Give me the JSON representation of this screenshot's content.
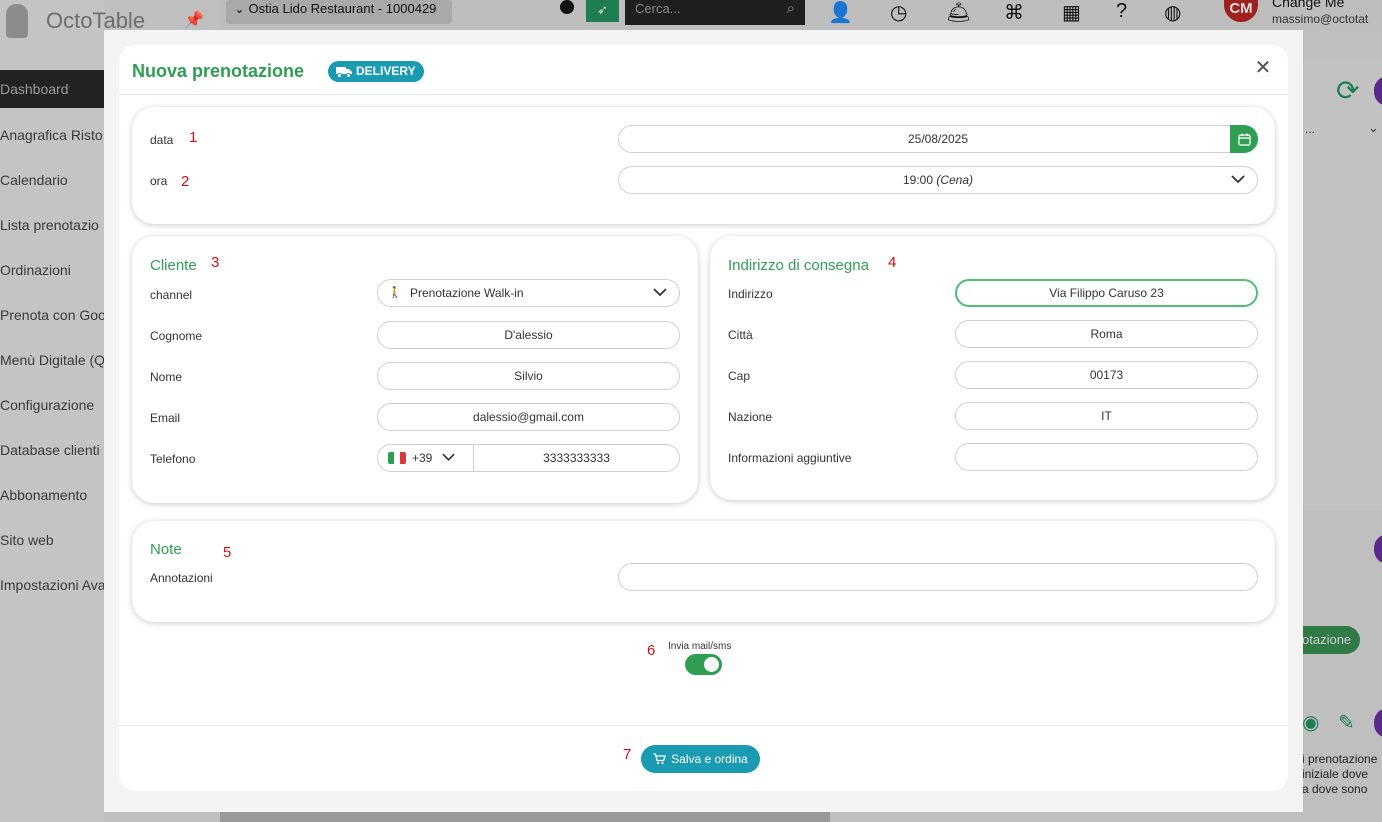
{
  "background": {
    "app_name": "OctoTable",
    "restaurant_selector": "Ostia Lido Restaurant - 1000429",
    "search_placeholder": "Cerca...",
    "user_initials": "CM",
    "user_name": "Change Me",
    "user_email": "massimo@octotat",
    "nav": [
      "Dashboard",
      "Anagrafica Risto",
      "Calendario",
      "Lista prenotazio",
      "Ordinazioni",
      "Prenota con Goo",
      "Menù Digitale (Q",
      "Configurazione",
      "Database clienti",
      "Abbonamento",
      "Sito web",
      "Impostazioni Ava"
    ],
    "right_select": "...",
    "right_button": "otazione",
    "right_text": [
      "i prenotazione",
      "iniziale dove",
      "a dove sono"
    ]
  },
  "modal": {
    "title": "Nuova prenotazione",
    "badge": "DELIVERY",
    "date_time": {
      "date_label": "data",
      "date_value": "25/08/2025",
      "time_label": "ora",
      "time_value": "19:00",
      "time_service": "(Cena)"
    },
    "cliente": {
      "title": "Cliente",
      "channel_label": "channel",
      "channel_value": "Prenotazione Walk-in",
      "cognome_label": "Cognome",
      "cognome_value": "D'alessio",
      "nome_label": "Nome",
      "nome_value": "Silvio",
      "email_label": "Email",
      "email_value": "dalessio@gmail.com",
      "telefono_label": "Telefono",
      "phone_prefix": "+39",
      "phone_number": "3333333333"
    },
    "consegna": {
      "title": "Indirizzo di consegna",
      "indirizzo_label": "Indirizzo",
      "indirizzo_value": "Via Filippo Caruso 23",
      "citta_label": "Città",
      "citta_value": "Roma",
      "cap_label": "Cap",
      "cap_value": "00173",
      "nazione_label": "Nazione",
      "nazione_value": "IT",
      "info_label": "Informazioni aggiuntive",
      "info_value": ""
    },
    "note": {
      "title": "Note",
      "annotazioni_label": "Annotazioni",
      "annotazioni_value": ""
    },
    "notify_label": "Invia mail/sms",
    "notify_on": true,
    "save_label": "Salva e ordina"
  },
  "annotations": [
    "1",
    "2",
    "3",
    "4",
    "5",
    "6",
    "7"
  ],
  "colors": {
    "accent_green": "#2e9e52",
    "accent_teal": "#1b9ab3",
    "annotation_red": "#d01010"
  }
}
